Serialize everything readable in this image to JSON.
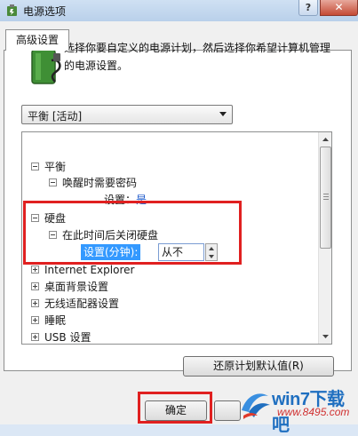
{
  "window": {
    "title": "电源选项",
    "help_glyph": "?",
    "close_glyph": "✕"
  },
  "tabs": [
    {
      "label": "高级设置"
    }
  ],
  "description": "选择你要自定义的电源计划，然后选择你希望计算机管理的电源设置。",
  "plan_select": {
    "value": "平衡 [活动]"
  },
  "tree": {
    "balanced": {
      "label": "平衡"
    },
    "wake_password": {
      "label": "唤醒时需要密码"
    },
    "wake_setting": {
      "label": "设置：",
      "value": "是"
    },
    "hard_disk": {
      "label": "硬盘"
    },
    "turn_off_disk": {
      "label": "在此时间后关闭硬盘"
    },
    "disk_setting": {
      "label": "设置(分钟):",
      "value": "从不"
    },
    "items": [
      {
        "label": "Internet Explorer"
      },
      {
        "label": "桌面背景设置"
      },
      {
        "label": "无线适配器设置"
      },
      {
        "label": "睡眠"
      },
      {
        "label": "USB 设置"
      }
    ]
  },
  "buttons": {
    "restore": "还原计划默认值(R)",
    "ok": "确定"
  },
  "watermark": {
    "title": "win7下载吧",
    "url": "www.8495.com"
  },
  "colors": {
    "highlight": "#e02020",
    "selection": "#3399ff",
    "link": "#1c57c9"
  }
}
